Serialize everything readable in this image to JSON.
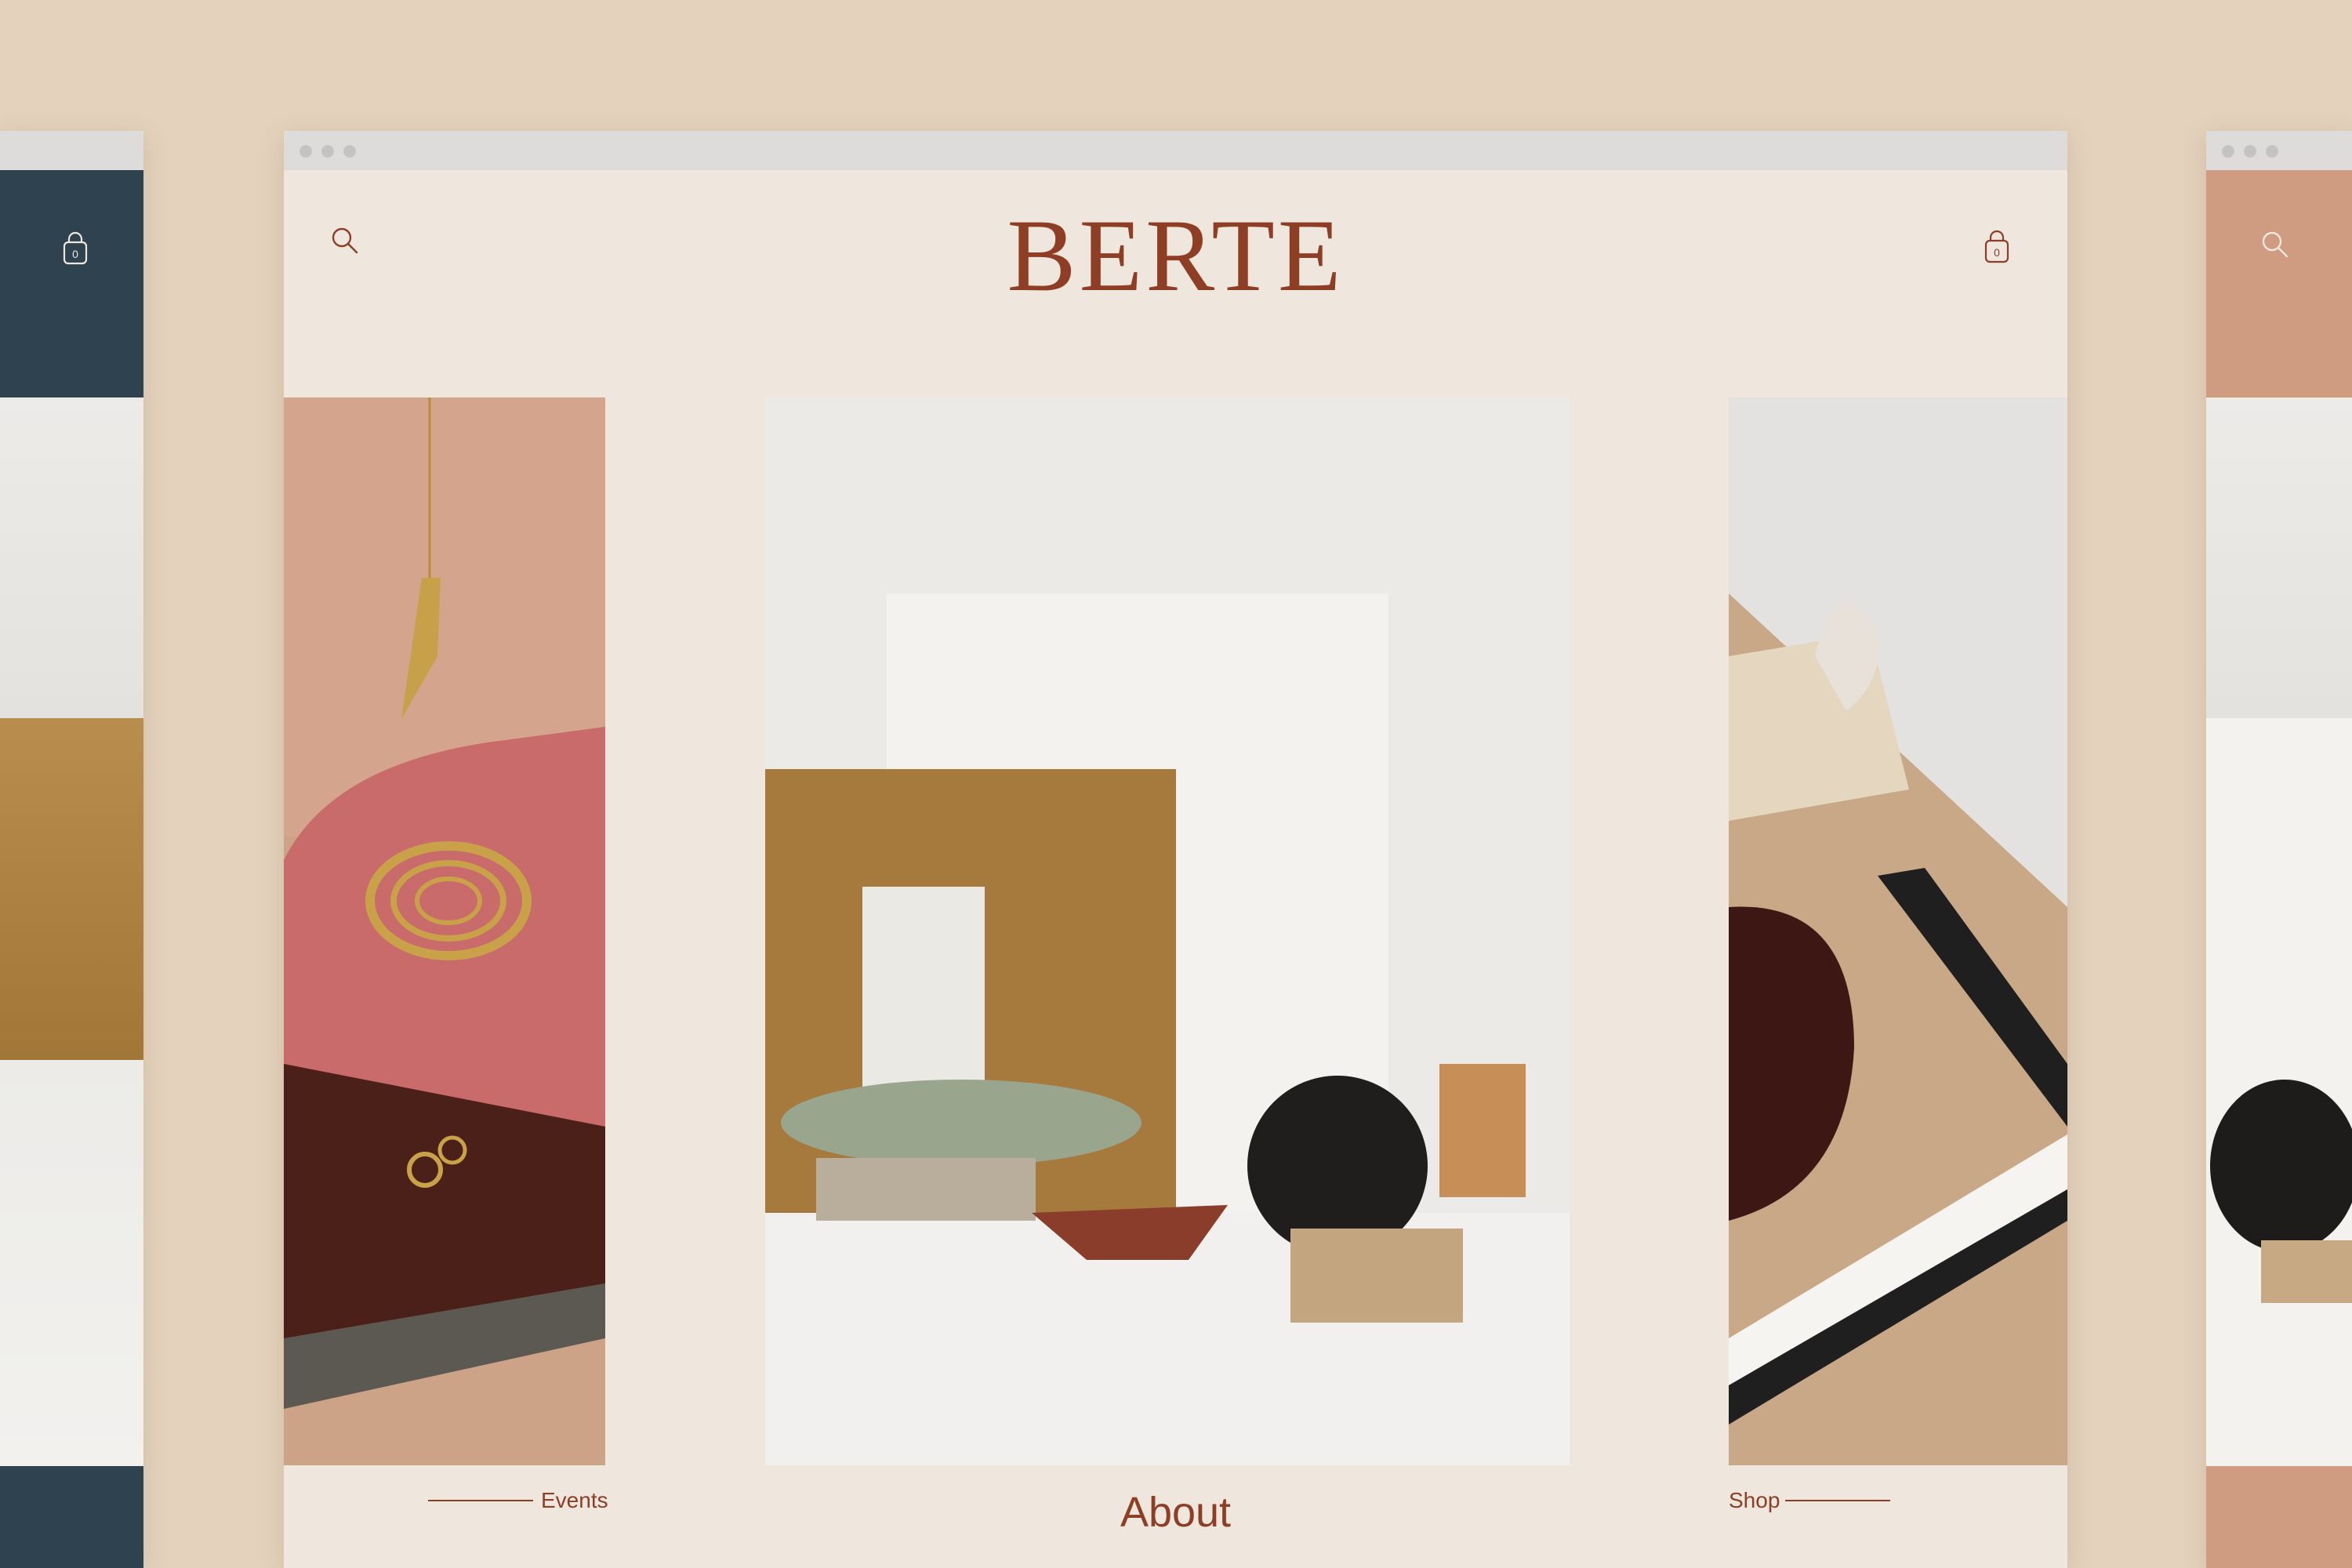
{
  "brand": {
    "logo_text": "BERTE",
    "accent_color": "#8d3e25",
    "background_color": "#e4d2bc",
    "page_color": "#efe6dd"
  },
  "header": {
    "search_icon": "search-icon",
    "cart_icon": "shopping-bag-icon",
    "cart_count": "0"
  },
  "nav": {
    "events_label": "Events",
    "about_label": "About",
    "shop_label": "Shop"
  },
  "side_windows": {
    "left_header_color": "#2f4250",
    "left_cart_count": "0",
    "right_header_color": "#cf9b81"
  }
}
